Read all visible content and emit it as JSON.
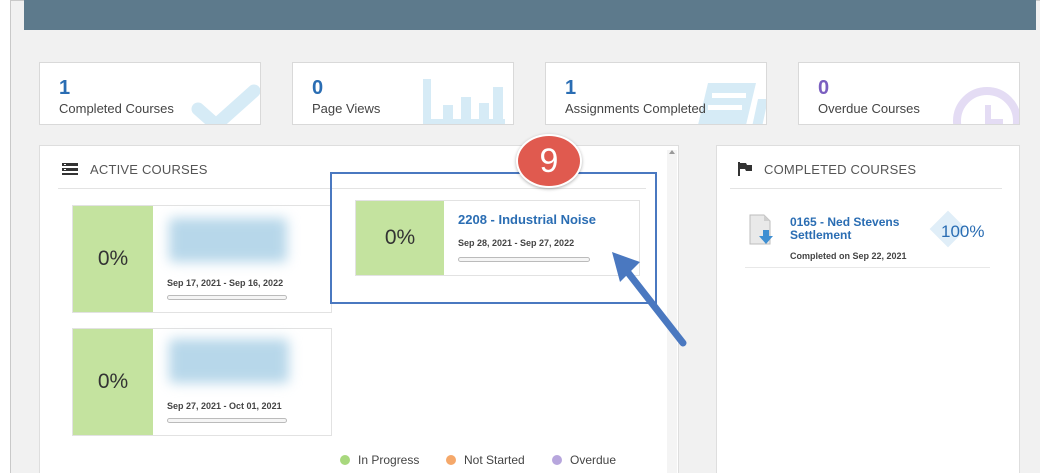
{
  "stats": [
    {
      "value": "1",
      "label": "Completed Courses",
      "icon": "checkmark-icon"
    },
    {
      "value": "0",
      "label": "Page Views",
      "icon": "bar-chart-icon"
    },
    {
      "value": "1",
      "label": "Assignments Completed",
      "icon": "assignment-icon"
    },
    {
      "value": "0",
      "label": "Overdue Courses",
      "icon": "clock-icon"
    }
  ],
  "active_courses": {
    "title": "ACTIVE COURSES",
    "cards": [
      {
        "percent": "0%",
        "name": "",
        "dates": "Sep 17, 2021 - Sep 16, 2022",
        "progress": 0
      },
      {
        "percent": "0%",
        "name": "2208 - Industrial Noise",
        "dates": "Sep 28, 2021 - Sep 27, 2022",
        "progress": 0
      },
      {
        "percent": "0%",
        "name": "",
        "dates": "Sep 27, 2021 - Oct 01, 2021",
        "progress": 0
      }
    ],
    "legend": [
      {
        "label": "In Progress",
        "color": "#a8d87d"
      },
      {
        "label": "Not Started",
        "color": "#f5a86a"
      },
      {
        "label": "Overdue",
        "color": "#b7a6dd"
      }
    ]
  },
  "completed_courses": {
    "title": "COMPLETED COURSES",
    "items": [
      {
        "name": "0165 - Ned Stevens Settlement",
        "completed": "Completed on Sep 22, 2021",
        "percent": "100%"
      }
    ]
  },
  "callout": {
    "step": "9"
  },
  "colors": {
    "header": "#5d7a8c",
    "accent": "#2a6db3",
    "progress_green": "#c4e39f",
    "callout_red": "#e05a4f",
    "highlight_blue": "#4a78c0"
  }
}
